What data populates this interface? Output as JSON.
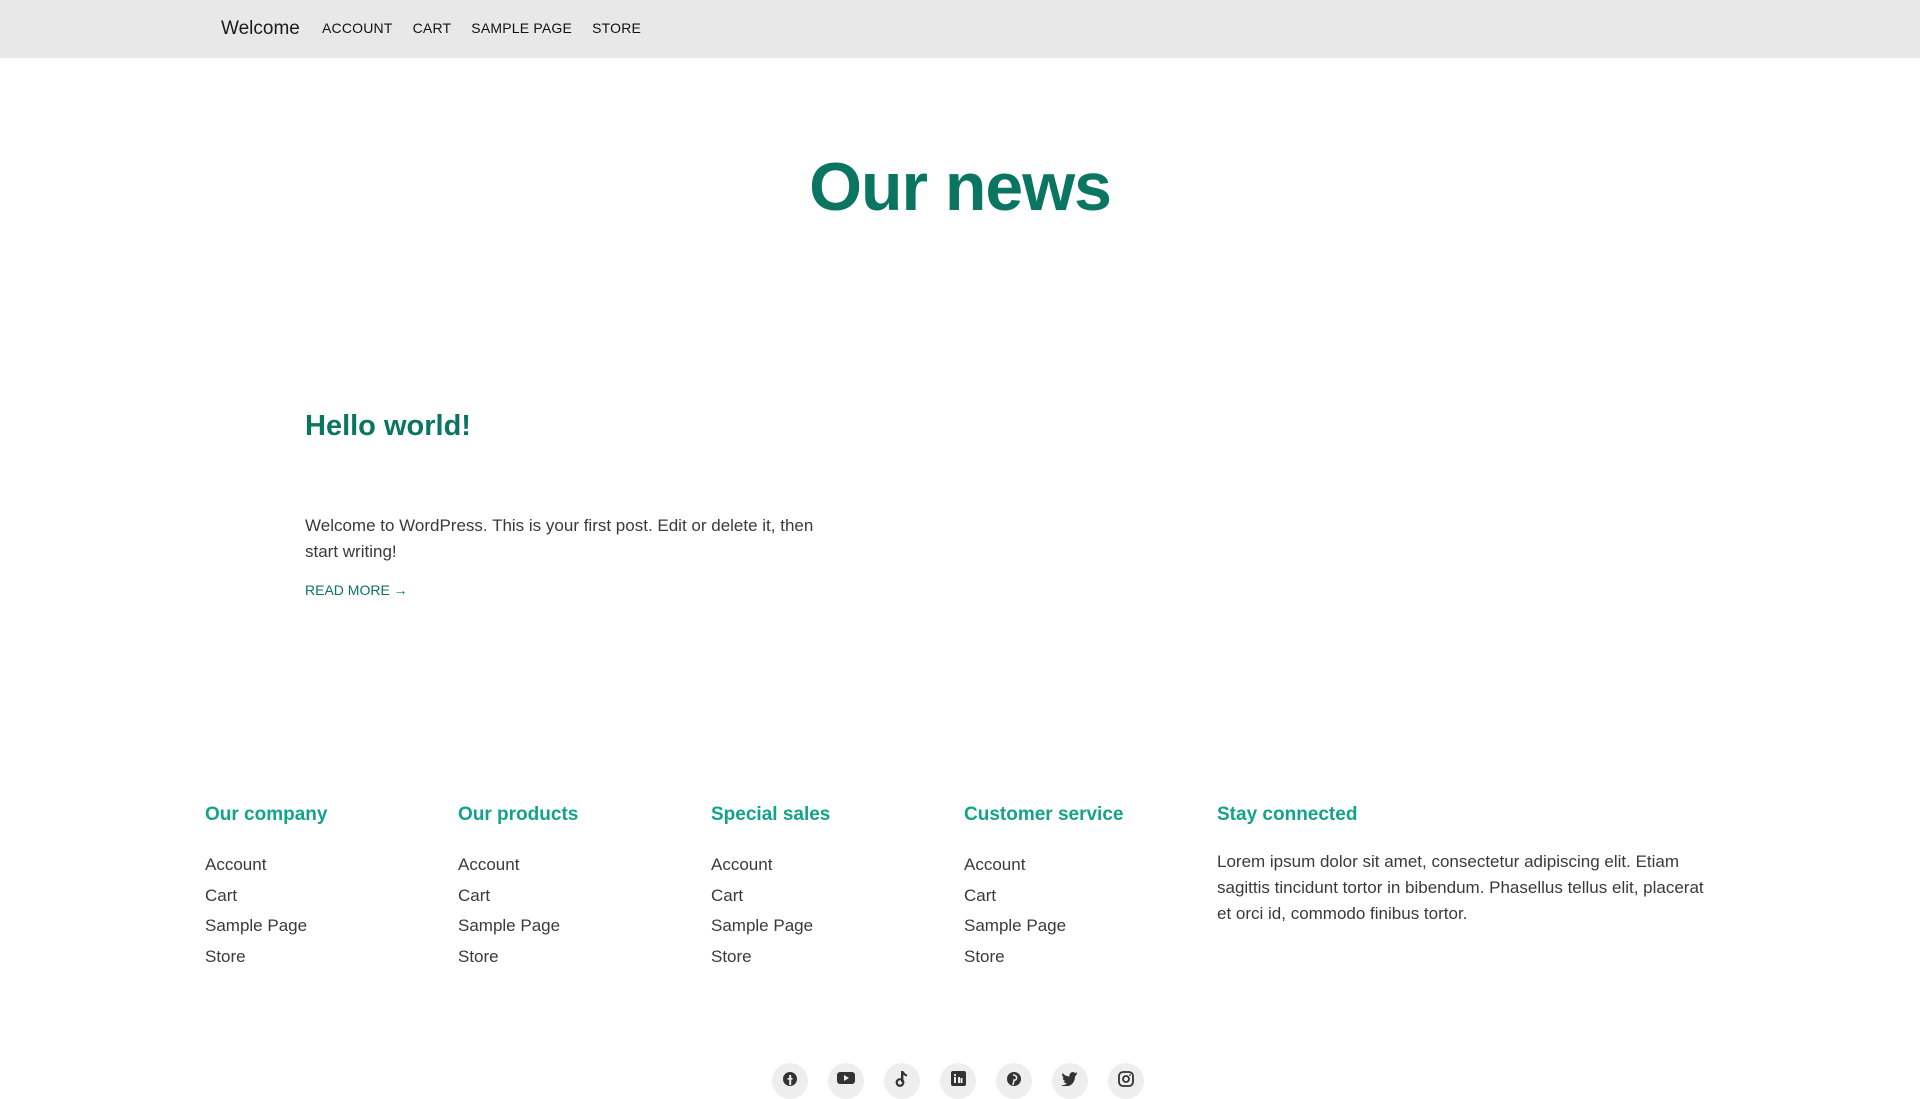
{
  "header": {
    "site_title": "Welcome",
    "nav": [
      "ACCOUNT",
      "CART",
      "SAMPLE PAGE",
      "STORE"
    ]
  },
  "main": {
    "page_title": "Our news",
    "post": {
      "title": "Hello world!",
      "excerpt": "Welcome to WordPress. This is your first post. Edit or delete it, then start writing!",
      "read_more": "READ MORE →"
    }
  },
  "footer": {
    "columns": [
      {
        "title": "Our company",
        "links": [
          "Account",
          "Cart",
          "Sample Page",
          "Store"
        ]
      },
      {
        "title": "Our products",
        "links": [
          "Account",
          "Cart",
          "Sample Page",
          "Store"
        ]
      },
      {
        "title": "Special sales",
        "links": [
          "Account",
          "Cart",
          "Sample Page",
          "Store"
        ]
      },
      {
        "title": "Customer service",
        "links": [
          "Account",
          "Cart",
          "Sample Page",
          "Store"
        ]
      }
    ],
    "stay_connected": {
      "title": "Stay connected",
      "text": "Lorem ipsum dolor sit amet, consectetur adipiscing elit. Etiam sagittis tincidunt tortor in bibendum. Phasellus tellus elit, placerat et orci id, commodo finibus tortor."
    },
    "social_icons": [
      "facebook-icon",
      "youtube-icon",
      "tiktok-icon",
      "linkedin-icon",
      "pinterest-icon",
      "twitter-icon",
      "instagram-icon"
    ]
  },
  "colors": {
    "accent_dark": "#0a7560",
    "accent_light": "#14a388",
    "header_bg": "#e8e8e8"
  }
}
